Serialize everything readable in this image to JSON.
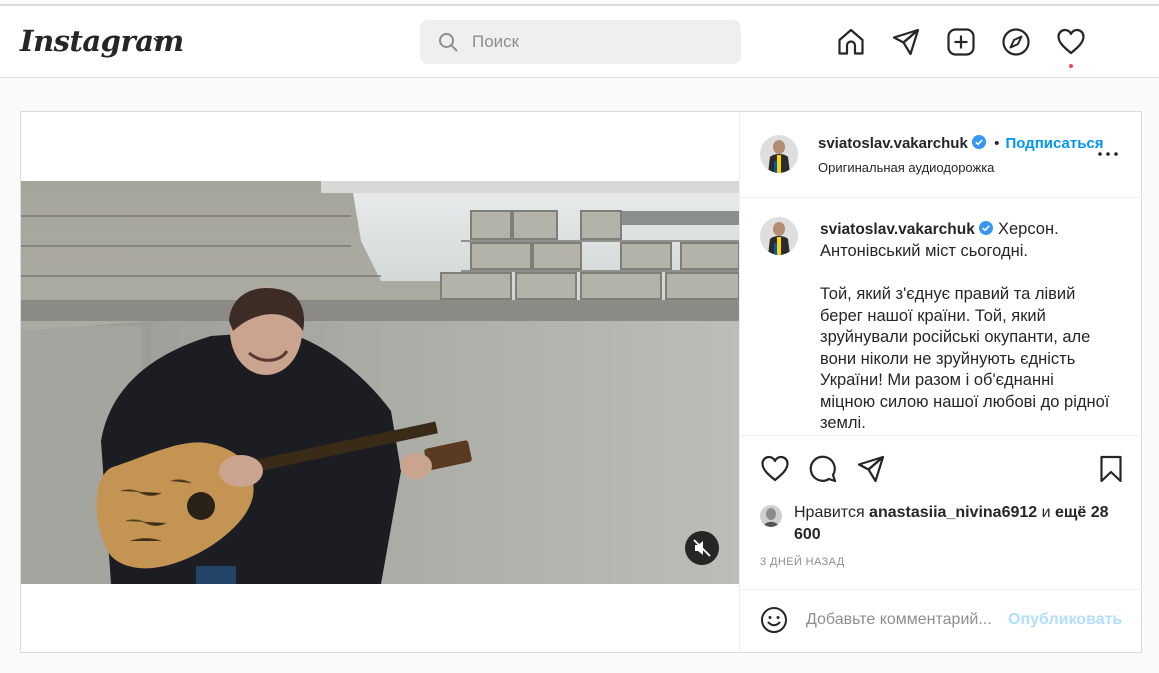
{
  "header": {
    "logo": "Instagram",
    "search": {
      "placeholder": "Поиск"
    },
    "icons": [
      "home-icon",
      "direct-icon",
      "new-post-icon",
      "explore-icon",
      "activity-icon"
    ]
  },
  "post": {
    "author": {
      "username": "sviatoslav.vakarchuk",
      "verified": true,
      "follow_label": "Подписаться",
      "separator": "•",
      "audio": "Оригинальная аудиодорожка"
    },
    "caption": {
      "username": "sviatoslav.vakarchuk",
      "line1": " Херсон. Антонівський міст сьогодні.",
      "paragraph2": "Той, який з'єднує правий та лівий берег нашої країни. Той, який зруйнували російські окупанти, але вони ніколи не зруйнують єдність України! Ми разом і об'єднанні міцною силою нашої любові до рідної землі."
    },
    "likes": {
      "prefix": "Нравится ",
      "user": "anastasiia_nivina6912",
      "middle": " и ",
      "others": "ещё 28 600"
    },
    "timestamp": "3 ДНЕЙ НАЗАД",
    "comment": {
      "placeholder": "Добавьте комментарий...",
      "publish_label": "Опубликовать"
    }
  },
  "colors": {
    "accent": "#0095f6",
    "publish_disabled": "#b2dffc",
    "verified": "#3897f0",
    "notification_dot": "#ed4956"
  }
}
